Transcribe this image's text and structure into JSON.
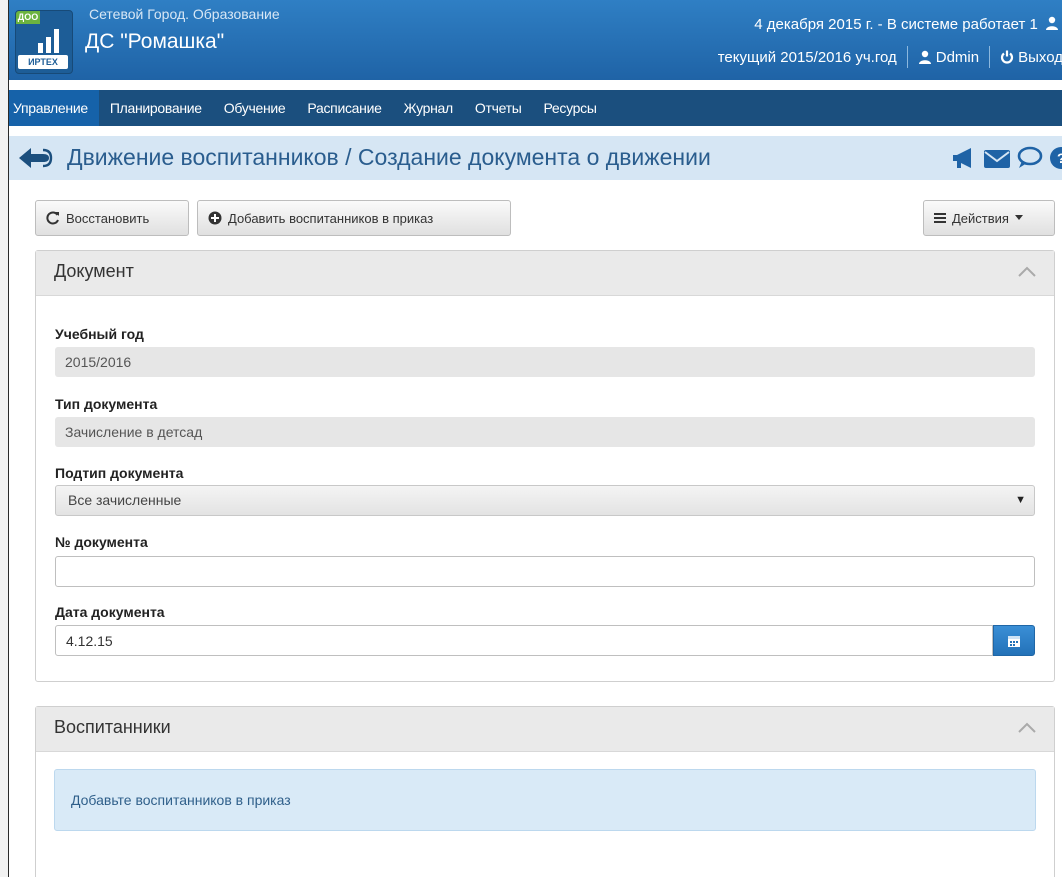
{
  "header": {
    "logo_badge": "ДОО",
    "logo_text": "ИРТЕХ",
    "app_name": "Сетевой Город. Образование",
    "org_name": "ДС \"Ромашка\"",
    "status_line": "4 декабря 2015 г. - В системе работает 1",
    "year_label": "текущий 2015/2016 уч.год",
    "user_label": "Ddmin",
    "logout_label": "Выход"
  },
  "nav": {
    "items": [
      {
        "label": "Управление"
      },
      {
        "label": "Планирование"
      },
      {
        "label": "Обучение"
      },
      {
        "label": "Расписание"
      },
      {
        "label": "Журнал"
      },
      {
        "label": "Отчеты"
      },
      {
        "label": "Ресурсы"
      }
    ]
  },
  "titlebar": {
    "title": "Движение воспитанников / Создание документа о движении"
  },
  "toolbar": {
    "restore_label": "Восстановить",
    "add_students_label": "Добавить воспитанников в приказ",
    "actions_label": "Действия"
  },
  "document_panel": {
    "title": "Документ",
    "fields": {
      "year_label": "Учебный год",
      "year_value": "2015/2016",
      "type_label": "Тип документа",
      "type_value": "Зачисление в детсад",
      "subtype_label": "Подтип документа",
      "subtype_value": "Все зачисленные",
      "number_label": "№ документа",
      "number_value": "",
      "date_label": "Дата документа",
      "date_value": "4.12.15"
    }
  },
  "students_panel": {
    "title": "Воспитанники",
    "info_text": "Добавьте воспитанников в приказ"
  },
  "colors": {
    "header_bg": "#2f7fc4",
    "nav_bg": "#1b4f7e",
    "nav_active": "#1662a9",
    "titlebar_bg": "#d6e6f4",
    "title_text": "#2a5d8e"
  }
}
